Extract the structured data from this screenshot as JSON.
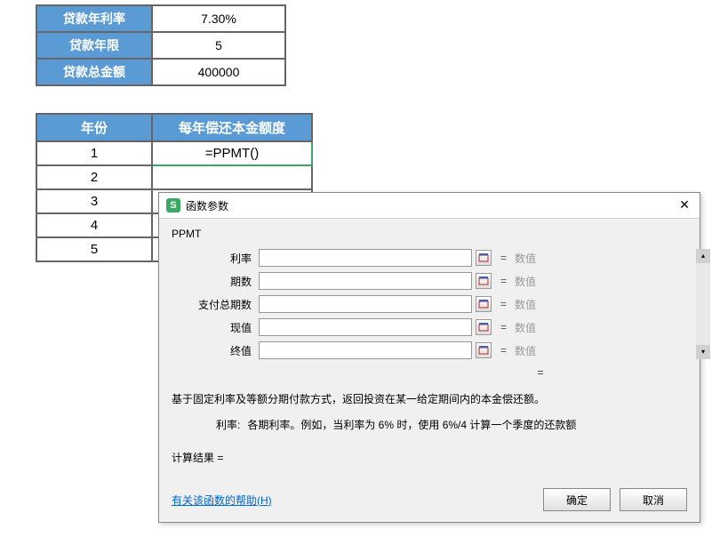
{
  "loan": {
    "rate_label": "贷款年利率",
    "rate_value": "7.30%",
    "years_label": "贷款年限",
    "years_value": "5",
    "amount_label": "贷款总金额",
    "amount_value": "400000"
  },
  "year_table": {
    "header_year": "年份",
    "header_principal": "每年偿还本金额度",
    "formula": "=PPMT()",
    "years": [
      "1",
      "2",
      "3",
      "4",
      "5"
    ]
  },
  "dialog": {
    "title": "函数参数",
    "func_name": "PPMT",
    "params": [
      {
        "label": "利率",
        "value": "",
        "result": "数值"
      },
      {
        "label": "期数",
        "value": "",
        "result": "数值"
      },
      {
        "label": "支付总期数",
        "value": "",
        "result": "数值"
      },
      {
        "label": "现值",
        "value": "",
        "result": "数值"
      },
      {
        "label": "终值",
        "value": "",
        "result": "数值"
      }
    ],
    "overall_eq": "=",
    "desc_main": "基于固定利率及等额分期付款方式，返回投资在某一给定期间内的本金偿还额。",
    "desc_param_name": "利率:",
    "desc_param_text": "各期利率。例如，当利率为 6% 时，使用 6%/4 计算一个季度的还款额",
    "calc_label": "计算结果 =",
    "help_text": "有关该函数的帮助(H)",
    "ok": "确定",
    "cancel": "取消"
  }
}
